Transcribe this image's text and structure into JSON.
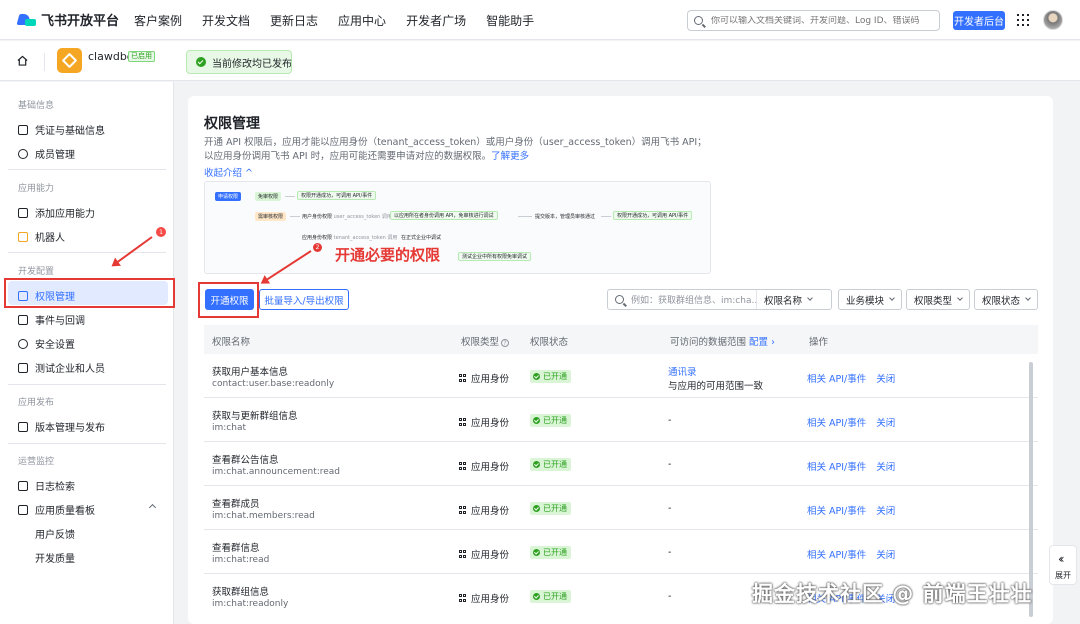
{
  "topnav": {
    "brand": "飞书开放平台",
    "links": [
      "客户案例",
      "开发文档",
      "更新日志",
      "应用中心",
      "开发者广场",
      "智能助手"
    ],
    "search_placeholder": "你可以输入文档关键词、开发问题、Log ID、错误码",
    "dev_console": "开发者后台"
  },
  "appbar": {
    "app_name": "clawdbot",
    "app_badge": "已启用",
    "publish_status": "当前修改均已发布"
  },
  "sidebar": {
    "sections": [
      {
        "title": "基础信息",
        "items": [
          "凭证与基础信息",
          "成员管理"
        ]
      },
      {
        "title": "应用能力",
        "items": [
          "添加应用能力",
          "机器人"
        ]
      },
      {
        "title": "开发配置",
        "items": [
          "权限管理",
          "事件与回调",
          "安全设置",
          "测试企业和人员"
        ]
      },
      {
        "title": "应用发布",
        "items": [
          "版本管理与发布"
        ]
      },
      {
        "title": "运营监控",
        "items": [
          "日志检索",
          "应用质量看板"
        ]
      }
    ],
    "sub_items": [
      "用户反馈",
      "开发质量"
    ],
    "robot_badge": "1",
    "active_item": "权限管理"
  },
  "main": {
    "title": "权限管理",
    "description": "开通 API 权限后，应用才能以应用身份（tenant_access_token）或用户身份（user_access_token）调用飞书 API；以应用身份调用飞书 API 时，应用可能还需要申请对应的数据权限。",
    "learn_more": "了解更多",
    "collapse": "收起介绍",
    "flow": {
      "apply": "申请权限",
      "free_perm": "免审权限",
      "free_result": "权限开通成功，可调用 API/事件",
      "review_perm": "需审核权限",
      "user_identity": "用户身份权限",
      "user_identity_note": "user_access_token 调用",
      "test_step": "以应用所在者身份调用 API，免审核进行调试",
      "submit_step": "提交版本，管理员审核通过",
      "final_result": "权限开通成功，可调用 API/事件",
      "app_identity": "应用身份权限",
      "app_identity_note": "tenant_access_token 调用",
      "enterprise": "在正式企业中调试",
      "test_enterprise": "测试企业中所有权限免审调试"
    },
    "annotation": "开通必要的权限",
    "annotation_num": "2",
    "sidebar_annotation_num": "1",
    "btn_enable": "开通权限",
    "btn_batch": "批量导入/导出权限",
    "filter": {
      "search_placeholder": "例如：获取群组信息、im:cha...",
      "search_field": "权限名称",
      "business": "业务模块",
      "perm_type": "权限类型",
      "perm_status": "权限状态"
    },
    "table": {
      "headers": {
        "name": "权限名称",
        "type": "权限类型",
        "status": "权限状态",
        "scope": "可访问的数据范围",
        "scope_link": "配置",
        "ops": "操作"
      },
      "rows": [
        {
          "name": "获取用户基本信息",
          "code": "contact:user.base:readonly",
          "type": "应用身份",
          "status": "已开通",
          "scope_link": "通讯录",
          "scope_text": "与应用的可用范围一致",
          "op1": "相关 API/事件",
          "op2": "关闭"
        },
        {
          "name": "获取与更新群组信息",
          "code": "im:chat",
          "type": "应用身份",
          "status": "已开通",
          "scope": "-",
          "op1": "相关 API/事件",
          "op2": "关闭"
        },
        {
          "name": "查看群公告信息",
          "code": "im:chat.announcement:read",
          "type": "应用身份",
          "status": "已开通",
          "scope": "-",
          "op1": "相关 API/事件",
          "op2": "关闭"
        },
        {
          "name": "查看群成员",
          "code": "im:chat.members:read",
          "type": "应用身份",
          "status": "已开通",
          "scope": "-",
          "op1": "相关 API/事件",
          "op2": "关闭"
        },
        {
          "name": "查看群信息",
          "code": "im:chat:read",
          "type": "应用身份",
          "status": "已开通",
          "scope": "-",
          "op1": "相关 API/事件",
          "op2": "关闭"
        },
        {
          "name": "获取群组信息",
          "code": "im:chat:readonly",
          "type": "应用身份",
          "status": "已开通",
          "scope": "-",
          "op1": "相关 API/事件",
          "op2": "关闭"
        }
      ]
    }
  },
  "expand_label": "展开",
  "watermark": "掘金技术社区 @ 前端王壮壮"
}
